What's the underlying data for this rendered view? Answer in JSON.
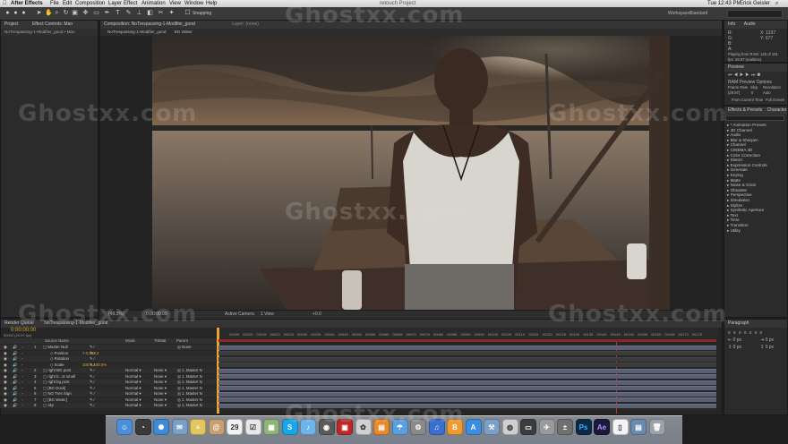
{
  "menubar": {
    "app": "After Effects",
    "items": [
      "File",
      "Edit",
      "Composition",
      "Layer",
      "Effect",
      "Animation",
      "View",
      "Window",
      "Help"
    ],
    "window_title": "retouch Project",
    "clock": "Tue 12:43 PM",
    "user": "Erick Geisler"
  },
  "toolbar": {
    "snapping": "Snapping",
    "workspace_label": "Workspace:",
    "workspace_value": "Standard"
  },
  "project": {
    "tab": "Project",
    "effect_controls": "Effect Controls: Man",
    "breadcrumb": "NoTrespassing-1-Modifier_good • Man"
  },
  "composition": {
    "tab": "Composition: NoTrespassing-1-Modifier_good",
    "layer_tab": "Layer: (none)",
    "sub_tabs": [
      "NoTrespassing-1-Modifier_good",
      "BG Water"
    ],
    "footer": {
      "zoom": "(49.3%)",
      "time": "0:00:00:00",
      "view": "Active Camera",
      "views": "1 View",
      "exposure": "+0.0"
    }
  },
  "info": {
    "tab": "Info",
    "audio_tab": "Audio",
    "r": "R:",
    "g": "G:",
    "b": "B:",
    "a": "A:",
    "x": "X: 1237",
    "y": "Y: 677",
    "playing": "Playing from RAM: 133 of 181",
    "fps": "fps: 29.97 (realtime)"
  },
  "preview": {
    "tab": "Preview",
    "ram_options": "RAM Preview Options",
    "frame_rate": "Frame Rate",
    "skip": "Skip",
    "resolution": "Resolution",
    "fr_value": "(29.97)",
    "skip_value": "0",
    "res_value": "Auto",
    "from_current": "From Current Time",
    "full_screen": "Full Screen"
  },
  "effects": {
    "tab": "Effects & Presets",
    "character_tab": "Character",
    "items": [
      "* Animation Presets",
      "3D Channel",
      "Audio",
      "Blur & Sharpen",
      "Channel",
      "CINEMA 4D",
      "Color Correction",
      "Distort",
      "Expression Controls",
      "Generate",
      "Keying",
      "Matte",
      "Noise & Grain",
      "Obsolete",
      "Perspective",
      "Simulation",
      "Stylize",
      "Synthetic Aperture",
      "Text",
      "Time",
      "Transition",
      "Utility"
    ]
  },
  "paragraph": {
    "tab": "Paragraph"
  },
  "timeline": {
    "render_queue_tab": "Render Queue",
    "comp_tab": "NoTrespassing-1-Modifier_good",
    "timecode": "0:00:00:00",
    "fps_sub": "00000 (29.97 fps)",
    "col_source": "Source Name",
    "col_mode": "Mode",
    "col_trkmat": "TrkMat",
    "col_parent": "Parent",
    "ticks": [
      "00005",
      "00010",
      "00015",
      "00020",
      "00025",
      "00030",
      "00035",
      "00040",
      "00045",
      "00050",
      "00055",
      "00060",
      "00065",
      "00070",
      "00075",
      "00080",
      "00085",
      "00090",
      "00095",
      "00100",
      "00105",
      "00110",
      "00115",
      "00120",
      "00125",
      "00130",
      "00135",
      "00140",
      "00145",
      "00150",
      "00155",
      "00160",
      "00165",
      "00170",
      "00175"
    ],
    "layers": [
      {
        "num": "1",
        "name": "Master Null",
        "mode": "",
        "trkmat": "",
        "parent": "None"
      },
      {
        "num": "",
        "name": "Position",
        "mode": "",
        "trkmat": "",
        "parent": "",
        "value": "7.0,293.2"
      },
      {
        "num": "",
        "name": "Rotation",
        "mode": "",
        "trkmat": "",
        "parent": ""
      },
      {
        "num": "",
        "name": "Scale",
        "mode": "",
        "trkmat": "",
        "parent": "",
        "value": "100.0,100.0%"
      },
      {
        "num": "2",
        "name": "right BG post",
        "mode": "Normal",
        "trkmat": "None",
        "parent": "1. Master N"
      },
      {
        "num": "3",
        "name": "right b...st small",
        "mode": "Normal",
        "trkmat": "None",
        "parent": "1. Master N"
      },
      {
        "num": "4",
        "name": "right bg post",
        "mode": "Normal",
        "trkmat": "None",
        "parent": "1. Master N"
      },
      {
        "num": "5",
        "name": "[BG Dock]",
        "mode": "Normal",
        "trkmat": "None",
        "parent": "1. Master N"
      },
      {
        "num": "6",
        "name": "NO Tres Sign",
        "mode": "Normal",
        "trkmat": "None",
        "parent": "1. Master N"
      },
      {
        "num": "7",
        "name": "[BG Water]",
        "mode": "Normal",
        "trkmat": "None",
        "parent": "1. Master N"
      },
      {
        "num": "8",
        "name": "sky",
        "mode": "Normal",
        "trkmat": "None",
        "parent": "1. Master N"
      }
    ]
  },
  "dock": {
    "apps": [
      {
        "name": "finder",
        "color": "#4a8fd8",
        "glyph": "☺"
      },
      {
        "name": "dashboard",
        "color": "#3a3a3a",
        "glyph": "◔"
      },
      {
        "name": "safari",
        "color": "#3f8ad8",
        "glyph": "✺"
      },
      {
        "name": "mail",
        "color": "#7aa0c8",
        "glyph": "✉"
      },
      {
        "name": "notes",
        "color": "#e4c660",
        "glyph": "≡"
      },
      {
        "name": "contacts",
        "color": "#c8a070",
        "glyph": "@"
      },
      {
        "name": "calendar",
        "color": "#f2f2f2",
        "glyph": "29"
      },
      {
        "name": "reminders",
        "color": "#e8e8e8",
        "glyph": "☑"
      },
      {
        "name": "photos",
        "color": "#8fb37a",
        "glyph": "▦"
      },
      {
        "name": "skype",
        "color": "#19a6e8",
        "glyph": "S"
      },
      {
        "name": "itunes-store",
        "color": "#6fb4e8",
        "glyph": "♪"
      },
      {
        "name": "facetime",
        "color": "#5a5a5a",
        "glyph": "◉"
      },
      {
        "name": "photo-booth",
        "color": "#c02828",
        "glyph": "▣"
      },
      {
        "name": "photos-app",
        "color": "#d0d0d0",
        "glyph": "✿"
      },
      {
        "name": "books",
        "color": "#e88a2a",
        "glyph": "▤"
      },
      {
        "name": "weather",
        "color": "#5aa0e0",
        "glyph": "☂"
      },
      {
        "name": "system-preferences",
        "color": "#8a8a8a",
        "glyph": "⚙"
      },
      {
        "name": "itunes",
        "color": "#3a6fd0",
        "glyph": "♫"
      },
      {
        "name": "ibooks",
        "color": "#f09a30",
        "glyph": "B"
      },
      {
        "name": "app-store",
        "color": "#3a8ee0",
        "glyph": "A"
      },
      {
        "name": "utilities",
        "color": "#7aa0c8",
        "glyph": "⚒"
      },
      {
        "name": "disk-utility",
        "color": "#cfcfcf",
        "glyph": "◍"
      },
      {
        "name": "activity",
        "color": "#3c3c3c",
        "glyph": "▭"
      },
      {
        "name": "automator",
        "color": "#9a9a9a",
        "glyph": "✈"
      },
      {
        "name": "calculator",
        "color": "#707070",
        "glyph": "±"
      },
      {
        "name": "photoshop",
        "color": "#0b2a46",
        "glyph": "Ps"
      },
      {
        "name": "after-effects",
        "color": "#1b1a3c",
        "glyph": "Ae"
      },
      {
        "name": "document",
        "color": "#f4f4f4",
        "glyph": "▯"
      },
      {
        "name": "downloads",
        "color": "#6a8ab0",
        "glyph": "▤"
      },
      {
        "name": "trash",
        "color": "#9aa2aa",
        "glyph": "🗑"
      }
    ]
  },
  "watermark": "Ghostxx.com"
}
